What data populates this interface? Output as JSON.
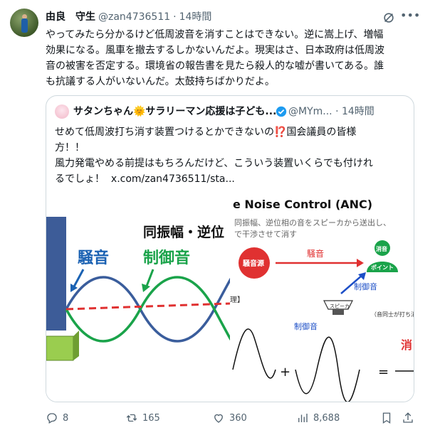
{
  "author": {
    "name": "由良　守生",
    "handle": "@zan4736511",
    "time": "14時間"
  },
  "tweet": {
    "lines": [
      "やってみたら分かるけど低周波音を消すことはできない。逆に嵩上げ、増幅",
      "効果になる。風車を撤去するしかないんだよ。現実はさ、日本政府は低周波",
      "音の被害を否定する。環境省の報告書を見たら殺人的な嘘が書いてある。誰",
      "も抗議する人がいないんだ。太鼓持ちばかりだよ。"
    ]
  },
  "quote": {
    "name": "サタンちゃん🌞サラリーマン応援は子ども...",
    "handle": "@MYm...",
    "time": "· 14時間",
    "lines": [
      "せめて低周波打ち消す装置つけるとかできないの⁉️国会議員の皆様",
      "方！！",
      "風力発電やめる前提はもちろんだけど、こういう装置いくらでも付けれ",
      "るでしょ！"
    ],
    "link": "x.com/zan4736511/sta...",
    "image": {
      "left_label_noise": "騒音",
      "left_label_same": "同振幅・逆位",
      "left_label_control": "制御音",
      "right_title": "e Noise Control (ANC)",
      "right_sub1": "同振幅、逆位相の音をスピーカから送出し、",
      "right_sub2": "で干渉させて消す",
      "source_label": "騒音源",
      "arrow_label": "騒音",
      "point_label1": "消音",
      "point_label2": "ポイント",
      "control_label": "制御音",
      "speaker_label": "スピーカ",
      "bottom_control": "制御音",
      "bracket_label": "理】",
      "right_note": "（音同士が打ち消",
      "plus": "+",
      "equals": "=",
      "erase": "消"
    }
  },
  "actions": {
    "replies": "8",
    "reposts": "165",
    "likes": "360",
    "views": "8,688"
  },
  "colors": {
    "accent": "#1d9bf0",
    "noise_wave": "#3a5d9c",
    "control_wave": "#1aa34a",
    "red": "#e03131"
  }
}
